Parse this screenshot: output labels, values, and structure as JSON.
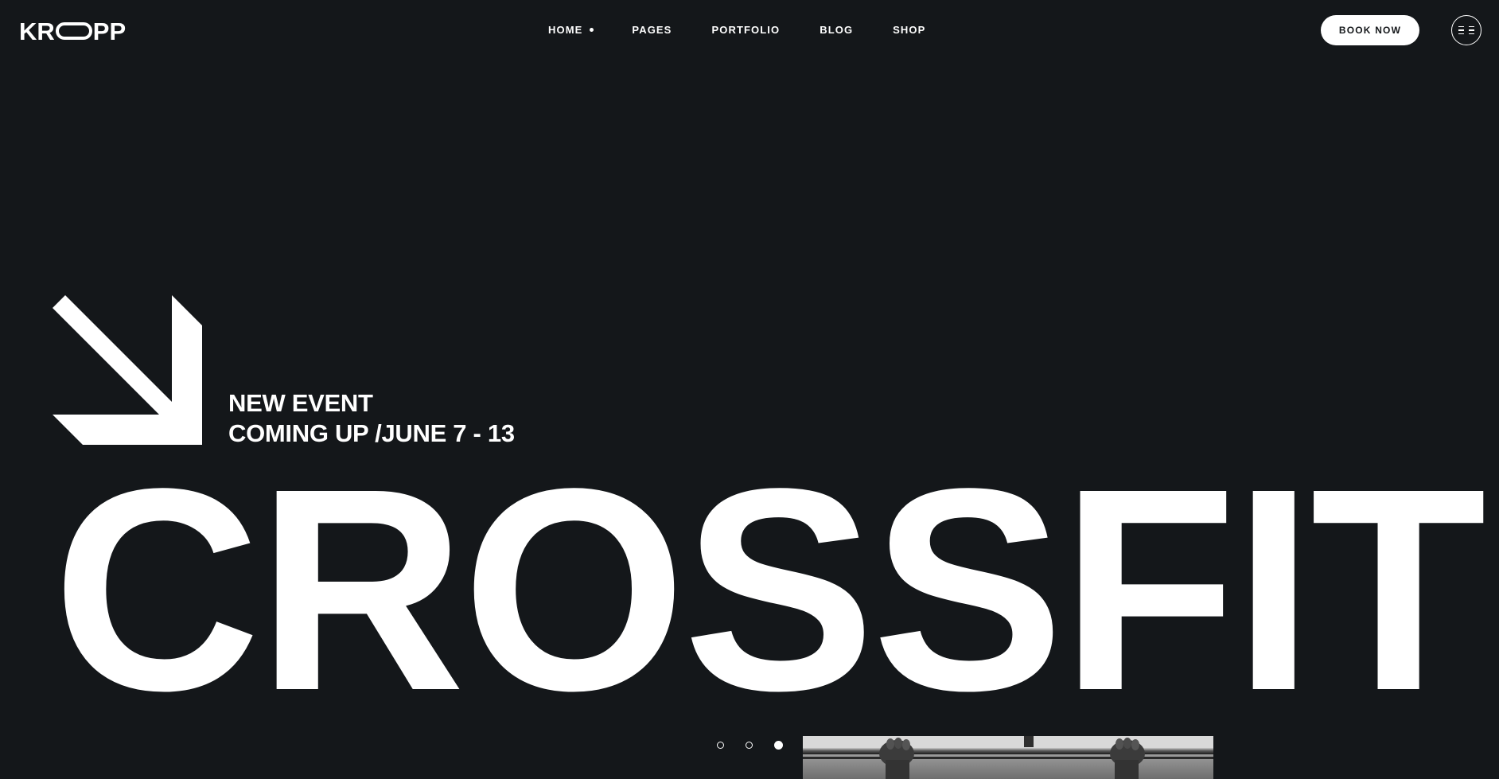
{
  "header": {
    "logo": "KROPP",
    "logo_parts": {
      "left": "KR",
      "right": "PP"
    },
    "nav": [
      {
        "label": "HOME",
        "active": true
      },
      {
        "label": "PAGES",
        "active": false
      },
      {
        "label": "PORTFOLIO",
        "active": false
      },
      {
        "label": "BLOG",
        "active": false
      },
      {
        "label": "SHOP",
        "active": false
      }
    ],
    "book_label": "BOOK NOW",
    "menu_icon": "hamburger-icon"
  },
  "hero": {
    "arrow_icon": "arrow-down-right-icon",
    "event_line1": "NEW EVENT",
    "event_line2": "COMING UP /JUNE 7 - 13",
    "headline": "CROSSFIT"
  },
  "slider": {
    "slide_count": 3,
    "active_index": 2
  },
  "photo": {
    "subject": "hands gripping pull-up bar (grayscale)"
  },
  "colors": {
    "background": "#14171a",
    "foreground": "#ffffff"
  }
}
